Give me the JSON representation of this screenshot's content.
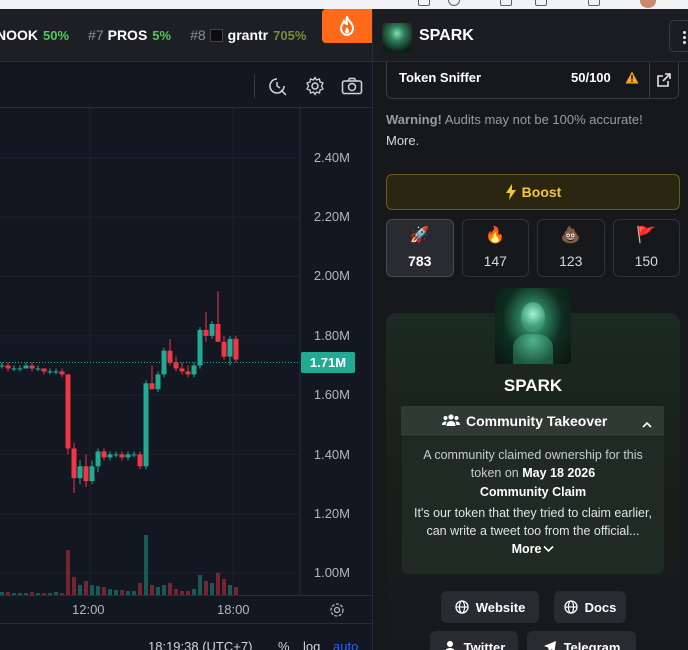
{
  "ticker": [
    {
      "rank": "",
      "name": "NOOK",
      "pct": "50%"
    },
    {
      "rank": "#7",
      "name": "PROS",
      "pct": "5%"
    },
    {
      "rank": "#8",
      "name": "grantr",
      "pct": "705%"
    }
  ],
  "chart": {
    "price_labels": [
      "2.40M",
      "2.20M",
      "2.00M",
      "1.80M",
      "1.60M",
      "1.40M",
      "1.20M",
      "1.00M"
    ],
    "last_price": "1.71M",
    "x_labels": [
      "12:00",
      "18:00"
    ],
    "status": {
      "time": "18:19:38 (UTC+7)",
      "percent": "%",
      "log": "log",
      "auto": "auto"
    }
  },
  "chart_data": {
    "type": "candlestick",
    "ylim": [
      1.0,
      2.5
    ],
    "units": "M",
    "candles": [
      {
        "o": 1.72,
        "h": 1.74,
        "l": 1.69,
        "c": 1.7
      },
      {
        "o": 1.7,
        "h": 1.71,
        "l": 1.69,
        "c": 1.7
      },
      {
        "o": 1.7,
        "h": 1.71,
        "l": 1.68,
        "c": 1.69
      },
      {
        "o": 1.69,
        "h": 1.7,
        "l": 1.68,
        "c": 1.69
      },
      {
        "o": 1.69,
        "h": 1.7,
        "l": 1.68,
        "c": 1.69
      },
      {
        "o": 1.69,
        "h": 1.71,
        "l": 1.69,
        "c": 1.7
      },
      {
        "o": 1.7,
        "h": 1.71,
        "l": 1.68,
        "c": 1.69
      },
      {
        "o": 1.69,
        "h": 1.7,
        "l": 1.68,
        "c": 1.69
      },
      {
        "o": 1.69,
        "h": 1.69,
        "l": 1.67,
        "c": 1.68
      },
      {
        "o": 1.68,
        "h": 1.69,
        "l": 1.67,
        "c": 1.68
      },
      {
        "o": 1.68,
        "h": 1.69,
        "l": 1.67,
        "c": 1.68
      },
      {
        "o": 1.68,
        "h": 1.69,
        "l": 1.66,
        "c": 1.67
      },
      {
        "o": 1.67,
        "h": 1.67,
        "l": 1.4,
        "c": 1.42
      },
      {
        "o": 1.42,
        "h": 1.44,
        "l": 1.27,
        "c": 1.32
      },
      {
        "o": 1.32,
        "h": 1.38,
        "l": 1.3,
        "c": 1.36
      },
      {
        "o": 1.36,
        "h": 1.4,
        "l": 1.29,
        "c": 1.31
      },
      {
        "o": 1.31,
        "h": 1.38,
        "l": 1.3,
        "c": 1.36
      },
      {
        "o": 1.36,
        "h": 1.42,
        "l": 1.34,
        "c": 1.41
      },
      {
        "o": 1.41,
        "h": 1.42,
        "l": 1.38,
        "c": 1.39
      },
      {
        "o": 1.39,
        "h": 1.41,
        "l": 1.38,
        "c": 1.4
      },
      {
        "o": 1.4,
        "h": 1.41,
        "l": 1.39,
        "c": 1.4
      },
      {
        "o": 1.4,
        "h": 1.41,
        "l": 1.38,
        "c": 1.39
      },
      {
        "o": 1.39,
        "h": 1.41,
        "l": 1.38,
        "c": 1.4
      },
      {
        "o": 1.4,
        "h": 1.41,
        "l": 1.39,
        "c": 1.4
      },
      {
        "o": 1.4,
        "h": 1.41,
        "l": 1.35,
        "c": 1.36
      },
      {
        "o": 1.36,
        "h": 1.65,
        "l": 1.35,
        "c": 1.64
      },
      {
        "o": 1.64,
        "h": 1.7,
        "l": 1.62,
        "c": 1.62
      },
      {
        "o": 1.62,
        "h": 1.68,
        "l": 1.61,
        "c": 1.67
      },
      {
        "o": 1.67,
        "h": 1.76,
        "l": 1.66,
        "c": 1.75
      },
      {
        "o": 1.75,
        "h": 1.79,
        "l": 1.7,
        "c": 1.71
      },
      {
        "o": 1.71,
        "h": 1.73,
        "l": 1.68,
        "c": 1.69
      },
      {
        "o": 1.69,
        "h": 1.71,
        "l": 1.67,
        "c": 1.68
      },
      {
        "o": 1.68,
        "h": 1.7,
        "l": 1.66,
        "c": 1.67
      },
      {
        "o": 1.67,
        "h": 1.71,
        "l": 1.66,
        "c": 1.7
      },
      {
        "o": 1.7,
        "h": 1.83,
        "l": 1.69,
        "c": 1.82
      },
      {
        "o": 1.82,
        "h": 1.88,
        "l": 1.78,
        "c": 1.8
      },
      {
        "o": 1.8,
        "h": 1.85,
        "l": 1.79,
        "c": 1.84
      },
      {
        "o": 1.84,
        "h": 1.95,
        "l": 1.78,
        "c": 1.78
      },
      {
        "o": 1.78,
        "h": 1.8,
        "l": 1.72,
        "c": 1.73
      },
      {
        "o": 1.73,
        "h": 1.8,
        "l": 1.7,
        "c": 1.79
      },
      {
        "o": 1.79,
        "h": 1.8,
        "l": 1.71,
        "c": 1.72
      }
    ]
  },
  "panel": {
    "title": "SPARK",
    "sniffer_label": "Token Sniffer",
    "sniffer_score": "50/100",
    "warning_bold": "Warning!",
    "warning_text": " Audits may not be 100% accurate!",
    "warning_more": "More.",
    "boost_label": "Boost",
    "reactions": [
      {
        "emoji": "🚀",
        "count": "783"
      },
      {
        "emoji": "🔥",
        "count": "147"
      },
      {
        "emoji": "💩",
        "count": "123"
      },
      {
        "emoji": "🚩",
        "count": "150"
      }
    ],
    "community": {
      "name": "SPARK",
      "takeover_label": "Community Takeover",
      "desc_pre": "A community claimed ownership for this token on ",
      "desc_date": "May 18 2026",
      "claim_title": "Community Claim",
      "claim_body": "It's our token that they tried to claim earlier, can write a tweet too from the official...",
      "more_label": "More"
    },
    "links": {
      "website": "Website",
      "docs": "Docs",
      "twitter": "Twitter",
      "telegram": "Telegram"
    }
  },
  "colors": {
    "up": "#22ab94",
    "down": "#f23645",
    "boost": "#f3c53d",
    "accent": "#ff6a1a"
  }
}
